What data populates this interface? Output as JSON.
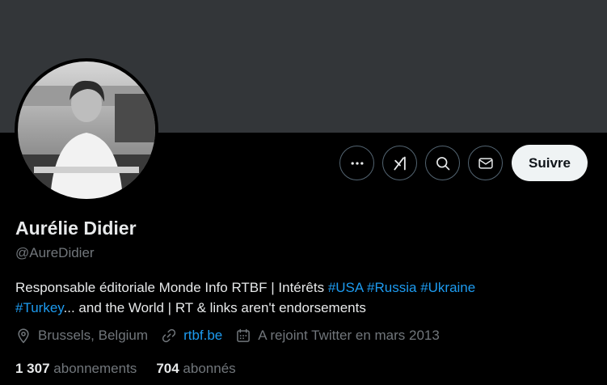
{
  "profile": {
    "name": "Aurélie Didier",
    "handle": "@AureDidier",
    "bio": {
      "p1": "Responsable éditoriale Monde Info RTBF | Intérêts ",
      "tag1": "#USA",
      "tag2": "#Russia",
      "tag3": "#Ukraine",
      "tag4": "#Turkey",
      "p2": "... and the World | RT & links aren't endorsements"
    },
    "location": "Brussels, Belgium",
    "website": "rtbf.be",
    "joined": "A rejoint Twitter en mars 2013"
  },
  "stats": {
    "following_count": "1 307",
    "following_label": "abonnements",
    "followers_count": "704",
    "followers_label": "abonnés"
  },
  "actions": {
    "follow_label": "Suivre",
    "icons": [
      "more-icon",
      "grok-icon",
      "search-icon",
      "message-icon"
    ]
  },
  "colors": {
    "background": "#000000",
    "banner": "#333639",
    "text": "#e7e9ea",
    "secondary": "#71767b",
    "accent": "#1d9bf0",
    "button_bg": "#eff3f4"
  }
}
